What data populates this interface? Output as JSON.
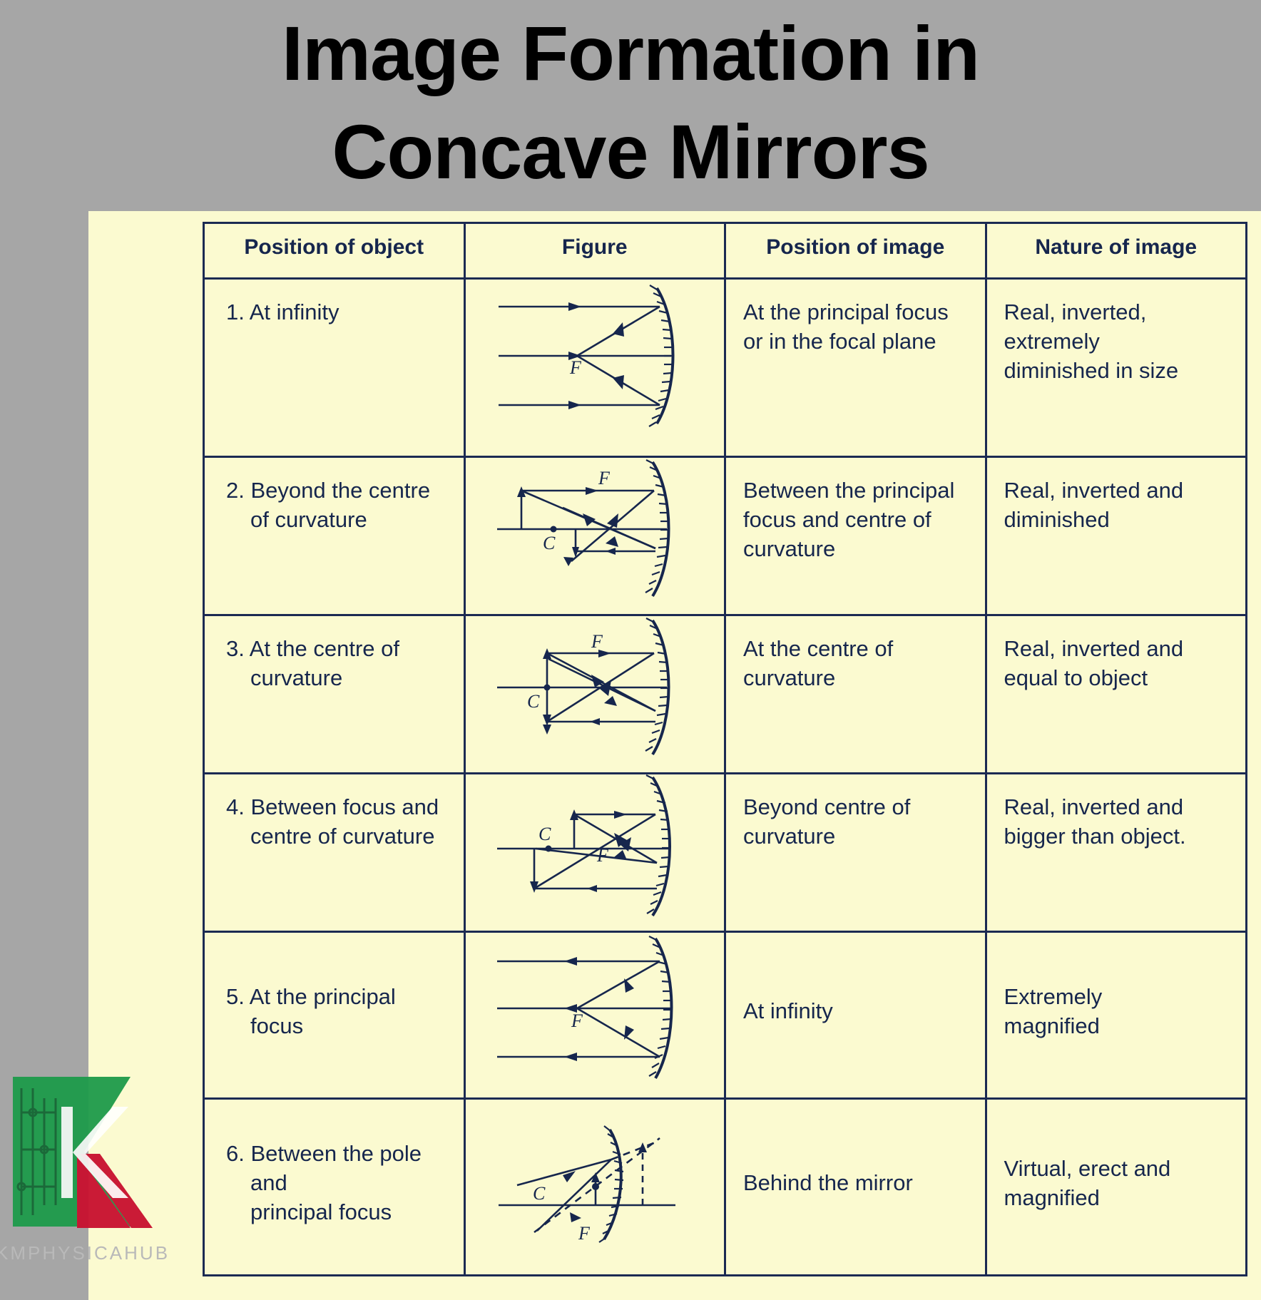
{
  "title": {
    "line1": "Image Formation in",
    "line2": "Concave Mirrors"
  },
  "colors": {
    "background": "#a6a6a6",
    "panel": "#fbfad0",
    "ink": "#16264d",
    "border": "#1b2a52",
    "logo_green": "#1e9b4b",
    "logo_red": "#c8102e",
    "watermark": "#b9b9b9"
  },
  "watermark": {
    "text": "KMPHYSICAHUB",
    "logo_letter": "K"
  },
  "table": {
    "headers": [
      "Position of object",
      "Figure",
      "Position of image",
      "Nature of image"
    ],
    "rows": [
      {
        "position_of_object": "1. At infinity",
        "figure": "concave-mirror-object-at-infinity-diagram",
        "position_of_image": "At the principal focus\nor in the focal plane",
        "nature_of_image": "Real, inverted,\nextremely\ndiminished in size",
        "figure_labels": [
          "F"
        ]
      },
      {
        "position_of_object": "2. Beyond the centre\nof curvature",
        "figure": "concave-mirror-object-beyond-c-diagram",
        "position_of_image": "Between the principal\nfocus and centre of\ncurvature",
        "nature_of_image": "Real, inverted and\ndiminished",
        "figure_labels": [
          "F",
          "C"
        ]
      },
      {
        "position_of_object": "3. At the centre of\ncurvature",
        "figure": "concave-mirror-object-at-c-diagram",
        "position_of_image": "At the centre of\ncurvature",
        "nature_of_image": "Real, inverted and\nequal to object",
        "figure_labels": [
          "F",
          "C"
        ]
      },
      {
        "position_of_object": "4. Between focus and\ncentre of curvature",
        "figure": "concave-mirror-object-between-f-and-c-diagram",
        "position_of_image": "Beyond centre of\ncurvature",
        "nature_of_image": "Real, inverted and\nbigger than object.",
        "figure_labels": [
          "C",
          "F"
        ]
      },
      {
        "position_of_object": "5. At the principal\nfocus",
        "figure": "concave-mirror-object-at-f-diagram",
        "position_of_image": "At infinity",
        "nature_of_image": "Extremely\nmagnified",
        "figure_labels": [
          "F"
        ]
      },
      {
        "position_of_object": "6. Between the pole and\nprincipal focus",
        "figure": "concave-mirror-object-between-p-and-f-diagram",
        "position_of_image": "Behind the mirror",
        "nature_of_image": "Virtual, erect and\nmagnified",
        "figure_labels": [
          "C",
          "F"
        ]
      }
    ]
  }
}
